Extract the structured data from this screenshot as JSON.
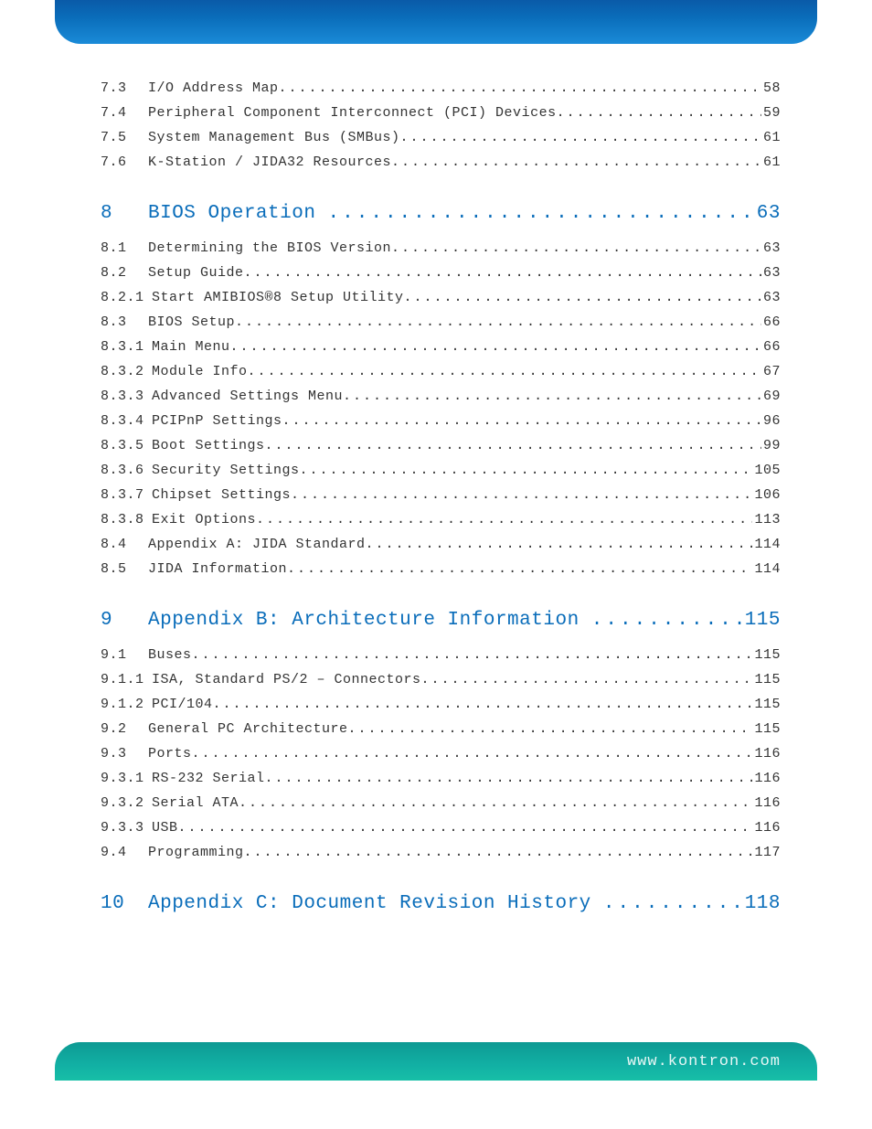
{
  "footer_url": "www.kontron.com",
  "toc": [
    {
      "type": "item",
      "num": "7.3",
      "title": "I/O Address Map",
      "page": "58"
    },
    {
      "type": "item",
      "num": "7.4",
      "title": "Peripheral Component Interconnect (PCI) Devices",
      "page": "59"
    },
    {
      "type": "item",
      "num": "7.5",
      "title": "System Management Bus (SMBus)",
      "page": "61"
    },
    {
      "type": "item",
      "num": "7.6",
      "title": "K-Station / JIDA32 Resources",
      "page": "61"
    },
    {
      "type": "chapter",
      "num": "8",
      "title": "BIOS Operation ",
      "page": " 63"
    },
    {
      "type": "item",
      "num": "8.1",
      "title": "Determining the BIOS Version",
      "page": "63"
    },
    {
      "type": "item",
      "num": "8.2",
      "title": "Setup Guide",
      "page": "63"
    },
    {
      "type": "sub",
      "num": "8.2.1",
      "title": "Start AMIBIOS®8 Setup Utility",
      "page": "63"
    },
    {
      "type": "item",
      "num": "8.3",
      "title": "BIOS Setup",
      "page": "66"
    },
    {
      "type": "sub",
      "num": "8.3.1",
      "title": "Main Menu",
      "page": "66"
    },
    {
      "type": "sub",
      "num": "8.3.2",
      "title": "Module Info",
      "page": "67"
    },
    {
      "type": "sub",
      "num": "8.3.3",
      "title": "Advanced Settings Menu",
      "page": "69"
    },
    {
      "type": "sub",
      "num": "8.3.4",
      "title": "PCIPnP Settings",
      "page": "96"
    },
    {
      "type": "sub",
      "num": "8.3.5",
      "title": "Boot Settings",
      "page": "99"
    },
    {
      "type": "sub",
      "num": "8.3.6",
      "title": "Security Settings",
      "page": "105"
    },
    {
      "type": "sub",
      "num": "8.3.7",
      "title": "Chipset Settings",
      "page": "106"
    },
    {
      "type": "sub",
      "num": "8.3.8",
      "title": "Exit Options",
      "page": "113"
    },
    {
      "type": "item",
      "num": "8.4",
      "title": "Appendix A: JIDA Standard",
      "page": "114"
    },
    {
      "type": "item",
      "num": "8.5",
      "title": "JIDA Information",
      "page": "114"
    },
    {
      "type": "chapter",
      "num": "9",
      "title": "Appendix B: Architecture Information ",
      "page": " 115"
    },
    {
      "type": "item",
      "num": "9.1",
      "title": "Buses",
      "page": "115"
    },
    {
      "type": "sub",
      "num": "9.1.1",
      "title": "ISA, Standard PS/2 – Connectors",
      "page": "115"
    },
    {
      "type": "sub",
      "num": "9.1.2",
      "title": "PCI/104",
      "page": "115"
    },
    {
      "type": "item",
      "num": "9.2",
      "title": "General PC Architecture",
      "page": "115"
    },
    {
      "type": "item",
      "num": "9.3",
      "title": "Ports",
      "page": "116"
    },
    {
      "type": "sub",
      "num": "9.3.1",
      "title": "RS-232 Serial",
      "page": "116"
    },
    {
      "type": "sub",
      "num": "9.3.2",
      "title": "Serial ATA",
      "page": "116"
    },
    {
      "type": "sub",
      "num": "9.3.3",
      "title": "USB",
      "page": "116"
    },
    {
      "type": "item",
      "num": "9.4",
      "title": "Programming",
      "page": "117"
    },
    {
      "type": "chapter",
      "num": "10",
      "title": "Appendix C: Document Revision History ",
      "page": " 118"
    }
  ]
}
